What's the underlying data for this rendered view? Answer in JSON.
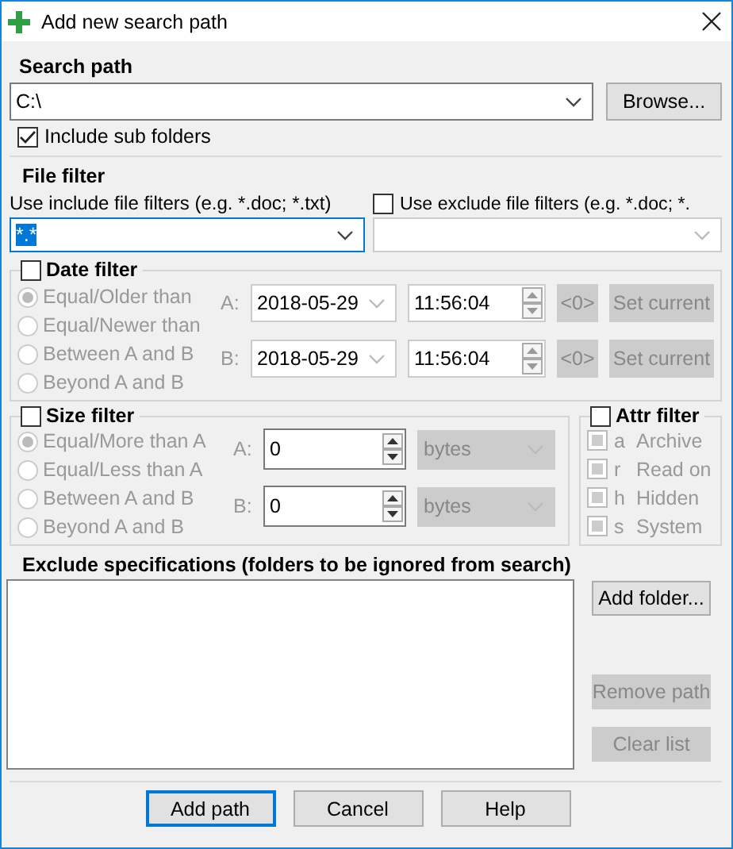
{
  "window": {
    "title": "Add new search path"
  },
  "search_path": {
    "label": "Search path",
    "value": "C:\\",
    "browse": "Browse...",
    "include_sub_folders": {
      "label": "Include sub folders",
      "checked": true
    }
  },
  "file_filter": {
    "title": "File filter",
    "include": {
      "label": "Use include file filters (e.g. *.doc; *.txt)",
      "value": "*.*",
      "value_selected": true
    },
    "exclude": {
      "label": "Use exclude file filters (e.g. *.doc; *.",
      "checked": false
    }
  },
  "date_filter": {
    "label": "Date filter",
    "checked": false,
    "options": [
      {
        "label": "Equal/Older than",
        "selected": true
      },
      {
        "label": "Equal/Newer than",
        "selected": false
      },
      {
        "label": "Between A and B",
        "selected": false
      },
      {
        "label": "Beyond A and B",
        "selected": false
      }
    ],
    "fields": [
      {
        "label": "A:",
        "date": "2018-05-29",
        "time": "11:56:04",
        "zero": "<0>",
        "set": "Set current"
      },
      {
        "label": "B:",
        "date": "2018-05-29",
        "time": "11:56:04",
        "zero": "<0>",
        "set": "Set current"
      }
    ]
  },
  "size_filter": {
    "label": "Size filter",
    "checked": false,
    "options": [
      {
        "label": "Equal/More than A",
        "selected": true
      },
      {
        "label": "Equal/Less than A",
        "selected": false
      },
      {
        "label": "Between A and B",
        "selected": false
      },
      {
        "label": "Beyond A and B",
        "selected": false
      }
    ],
    "fields": [
      {
        "label": "A:",
        "value": "0",
        "unit": "bytes"
      },
      {
        "label": "B:",
        "value": "0",
        "unit": "bytes"
      }
    ]
  },
  "attr_filter": {
    "label": "Attr filter",
    "checked": false,
    "items": [
      {
        "key": "a",
        "label": "Archive",
        "indeterminate": true
      },
      {
        "key": "r",
        "label": "Read on",
        "indeterminate": true
      },
      {
        "key": "h",
        "label": "Hidden",
        "indeterminate": true
      },
      {
        "key": "s",
        "label": "System",
        "indeterminate": true
      }
    ]
  },
  "exclude": {
    "title": "Exclude specifications (folders to be ignored from search)",
    "buttons": [
      {
        "label": "Add folder...",
        "disabled": false
      },
      {
        "label": "Remove path",
        "disabled": true
      },
      {
        "label": "Clear list",
        "disabled": true
      }
    ]
  },
  "buttons": [
    {
      "label": "Add path",
      "default": true
    },
    {
      "label": "Cancel",
      "default": false
    },
    {
      "label": "Help",
      "default": false
    }
  ]
}
